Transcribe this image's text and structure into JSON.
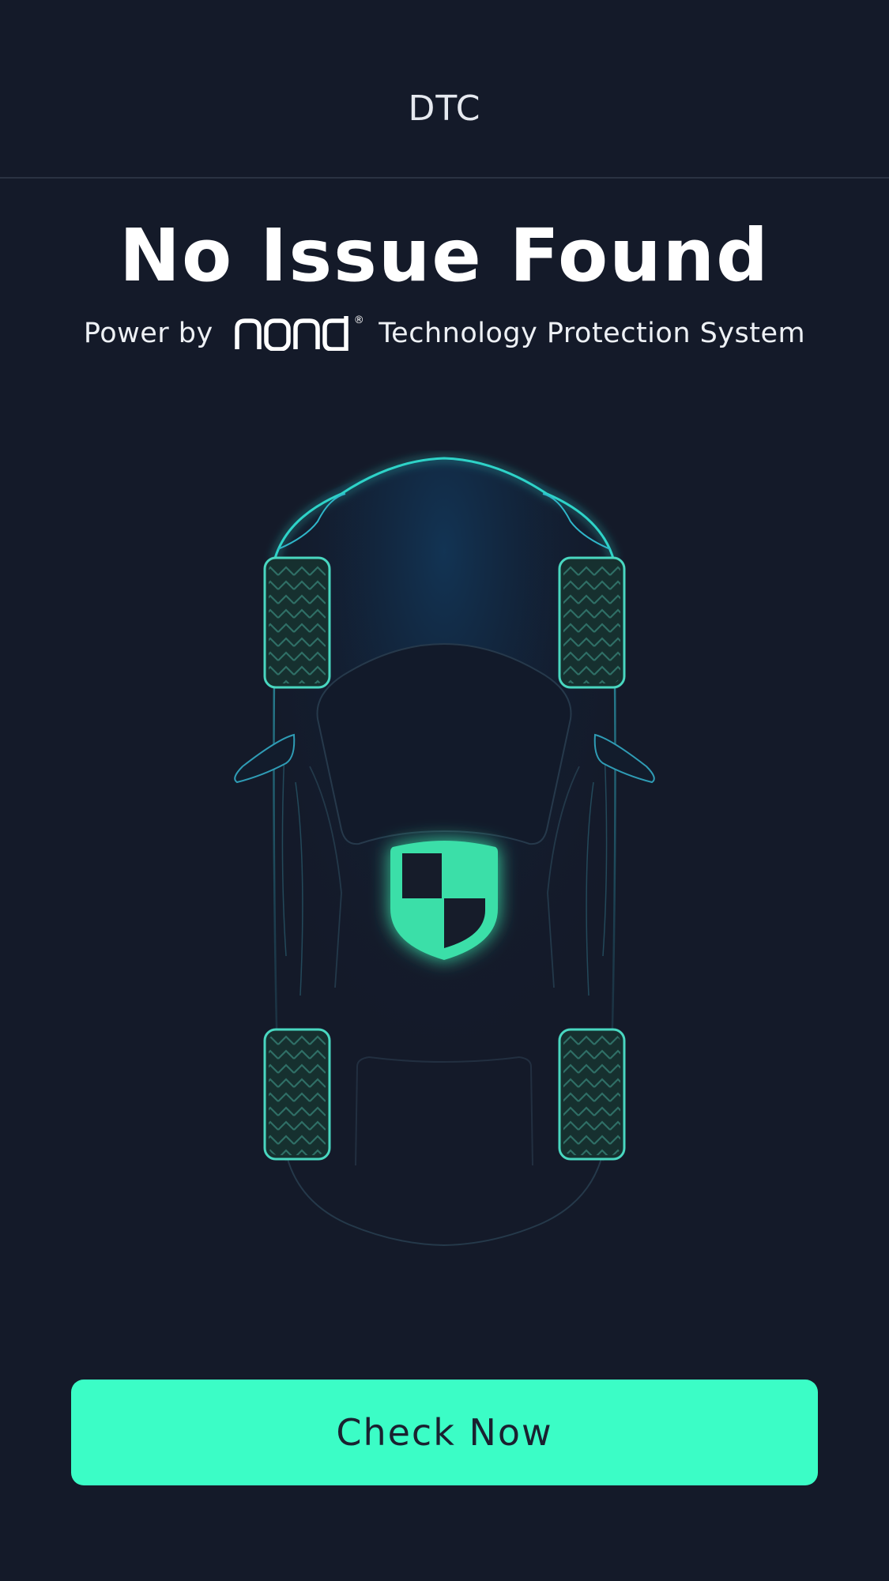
{
  "header": {
    "title": "DTC"
  },
  "status": {
    "headline": "No Issue Found",
    "powered_prefix": "Power by",
    "brand_logo_text": "nonda",
    "powered_suffix": "Technology Protection System"
  },
  "illustration": {
    "icon": "shield-icon",
    "accent_color": "#3bfdc6",
    "outline_color": "#2fb6c9"
  },
  "actions": {
    "check_now_label": "Check Now"
  },
  "colors": {
    "background": "#141a29",
    "button_background": "#3bfdc6",
    "button_text": "#1a2130"
  }
}
